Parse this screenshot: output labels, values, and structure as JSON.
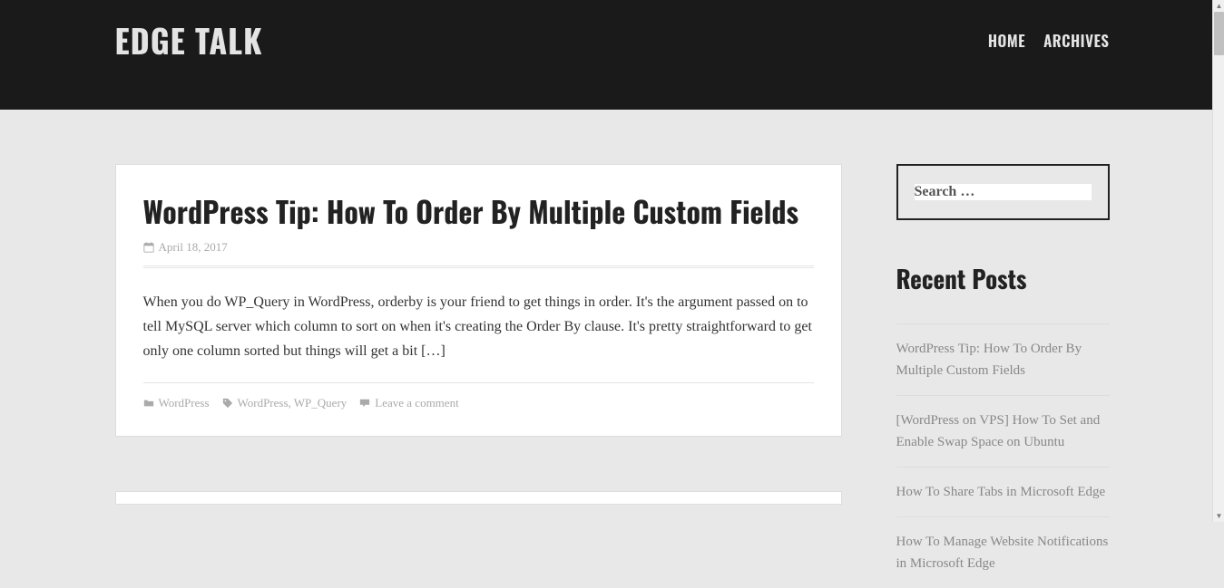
{
  "site": {
    "title": "EDGE TALK"
  },
  "nav": {
    "home": "HOME",
    "archives": "ARCHIVES"
  },
  "post": {
    "title": "WordPress Tip: How To Order By Multiple Custom Fields",
    "date": "April 18, 2017",
    "excerpt": "When you do WP_Query in WordPress, orderby is your friend to get things in order. It's the argument passed on to tell MySQL server which column to sort on when it's creating the Order By clause. It's pretty straightforward to get only one column sorted but things will get a bit […]",
    "category": "WordPress",
    "tags": "WordPress, WP_Query",
    "comment": "Leave a comment"
  },
  "search": {
    "placeholder": "Search …"
  },
  "sidebar": {
    "recent_title": "Recent Posts",
    "recent": [
      "WordPress Tip: How To Order By Multiple Custom Fields",
      "[WordPress on VPS] How To Set and Enable Swap Space on Ubuntu",
      "How To Share Tabs in Microsoft Edge",
      "How To Manage Website Notifications in Microsoft Edge"
    ]
  }
}
